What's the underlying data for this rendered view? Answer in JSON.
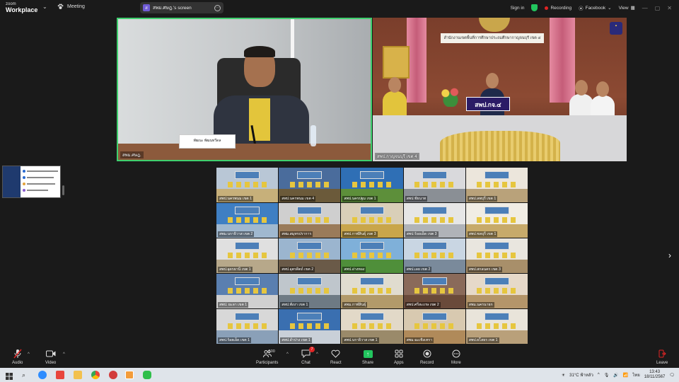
{
  "app": {
    "logo_line1": "zoom",
    "logo_line2": "Workplace",
    "meeting_label": "Meeting",
    "share_pill": {
      "avatar": "ส",
      "label": "สพม.ศษฎ.'s screen"
    }
  },
  "topbar_right": {
    "signin": "Sign in",
    "recording": "Recording",
    "facebook": "Facebook",
    "view": "View"
  },
  "main_videos": {
    "left": {
      "label": "สพม.ศษฎ.",
      "name_card": "พัฒนะ พัฒนทวีดล"
    },
    "right": {
      "label": "สพป.กาญจนบุรี เขต 4",
      "sign": "สำนักงานเขตพื้นที่การศึกษาประถมศึกษากาญจนบุรี เขต ๔",
      "placard": "สพป.กจ.๔"
    }
  },
  "gallery": {
    "tiles": [
      "สพป.นครพนม เขต 1",
      "สพป.นครพนม เขต 4",
      "สพป.นครปฐม เขต 1",
      "สพป.ชัยนาท",
      "สพป.ลพบุรี เขต 1",
      "สพม.นราธิวาส เขต 2",
      "สพม.สมุทรปราการ",
      "สพป.กาฬสินธุ์ เขต 3",
      "สพป.ร้อยเอ็ด เขต 3",
      "สพป.ชลบุรี เขต 1",
      "สพป.อุดรธานี เขต 1",
      "สพป.อุตรดิตถ์ เขต 2",
      "สพป.อ่างทอง",
      "สพป.เลย เขต 2",
      "สพป.สกลนคร เขต 3",
      "สพป. ยะลา เขต 1",
      "สพป.พังงา เขต 1",
      "สพม.กาฬสินธุ์",
      "สพป.ศรีสะเกษ เขต 2",
      "สพม.นครนายก",
      "สพป.ร้อยเอ็ด เขต 1",
      "สพป.ลำปาง เขต 1",
      "สพป.นราธิวาส เขต 1",
      "สพม.ฉะเชิงเทรา",
      "สพป.ยโสธร เขต 1"
    ],
    "tile_colors": [
      [
        "#b9c7d6",
        "#c7b07a"
      ],
      [
        "#4a6c9c",
        "#6b5a3a"
      ],
      [
        "#2f6fb5",
        "#5d8f3a"
      ],
      [
        "#d9d9dc",
        "#8a8f95"
      ],
      [
        "#ece6dc",
        "#b9a27a"
      ],
      [
        "#3f7fc3",
        "#a0b8cf"
      ],
      [
        "#cfcfcf",
        "#9a7b5a"
      ],
      [
        "#d9cfb8",
        "#c9a64b"
      ],
      [
        "#e6e6e6",
        "#b0b3b8"
      ],
      [
        "#f1ede4",
        "#c7aa6a"
      ],
      [
        "#e0e0e0",
        "#b7a88a"
      ],
      [
        "#9bb5cf",
        "#6a5a48"
      ],
      [
        "#7fb0d9",
        "#4f8f3a"
      ],
      [
        "#c9d6e3",
        "#7a8a9b"
      ],
      [
        "#e9e6df",
        "#a88f6a"
      ],
      [
        "#5a7fb0",
        "#d0d0d0"
      ],
      [
        "#bfc6cc",
        "#6e7a84"
      ],
      [
        "#e0dccf",
        "#b29a6a"
      ],
      [
        "#8a6a5a",
        "#6a4a3a"
      ],
      [
        "#e6d9c9",
        "#b4956a"
      ],
      [
        "#d8d8d8",
        "#8aa0b8"
      ],
      [
        "#3a6fb0",
        "#c9d0d8"
      ],
      [
        "#e2d9c8",
        "#9a8a6a"
      ],
      [
        "#d8c9b0",
        "#b08a5a"
      ],
      [
        "#e9e4da",
        "#b9a07a"
      ]
    ]
  },
  "toolbar": {
    "audio": "Audio",
    "video": "Video",
    "participants": "Participants",
    "participants_count": "500",
    "chat": "Chat",
    "chat_badge": "7",
    "react": "React",
    "share": "Share",
    "apps": "Apps",
    "record": "Record",
    "more": "More",
    "leave": "Leave"
  },
  "taskbar": {
    "weather": "31°C ฟ้าหลัว",
    "lang": "ไทย",
    "time": "13:43",
    "date": "18/11/2567"
  },
  "colors": {
    "active_speaker_border": "#3fcf6e",
    "share_green": "#22c55e",
    "recording_red": "#e02424"
  }
}
